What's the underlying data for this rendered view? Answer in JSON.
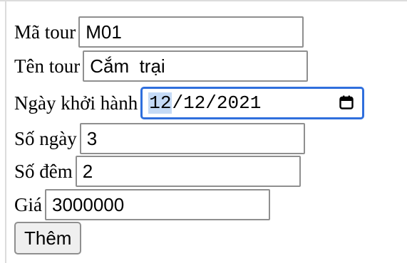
{
  "form": {
    "tour_code": {
      "label": "Mã tour",
      "value": "M01"
    },
    "tour_name": {
      "label": "Tên tour",
      "value": "Cắm  trại"
    },
    "start_date": {
      "label": "Ngày khởi hành",
      "day": "12",
      "separator1": "/",
      "month": "12",
      "separator2": "/",
      "year": "2021",
      "icon": "calendar-icon",
      "focus_color": "#2f6fdd"
    },
    "days": {
      "label": "Số ngày",
      "value": "3"
    },
    "nights": {
      "label": "Số đêm",
      "value": "2"
    },
    "price": {
      "label": "Giá",
      "value": "3000000"
    },
    "submit_label": "Thêm"
  }
}
